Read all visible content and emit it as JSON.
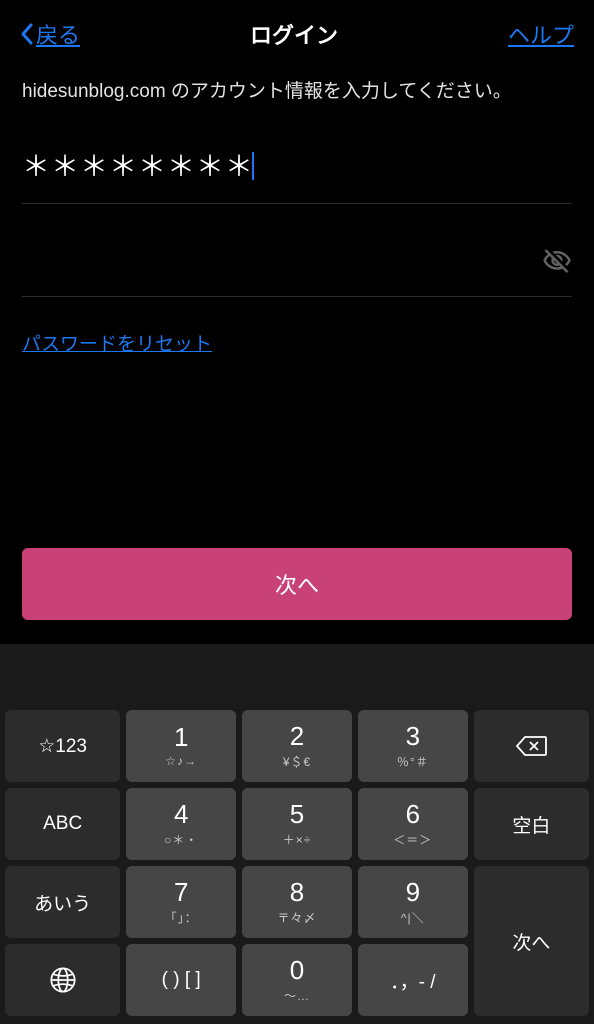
{
  "header": {
    "back_label": "戻る",
    "title": "ログイン",
    "help_label": "ヘルプ"
  },
  "form": {
    "instruction": "hidesunblog.com のアカウント情報を入力してください。",
    "username_mask": "＊＊＊＊＊＊＊＊",
    "reset_label": "パスワードをリセット",
    "next_button": "次へ"
  },
  "keyboard": {
    "keys": {
      "mode_symbol": "☆123",
      "k1": {
        "main": "1",
        "sub": "☆♪→"
      },
      "k2": {
        "main": "2",
        "sub": "¥＄€"
      },
      "k3": {
        "main": "3",
        "sub": "％°＃"
      },
      "abc": "ABC",
      "k4": {
        "main": "4",
        "sub": "○＊・"
      },
      "k5": {
        "main": "5",
        "sub": "＋×÷"
      },
      "k6": {
        "main": "6",
        "sub": "＜＝＞"
      },
      "space": "空白",
      "kana": "あいう",
      "k7": {
        "main": "7",
        "sub": "「」："
      },
      "k8": {
        "main": "8",
        "sub": "〒々〆"
      },
      "k9": {
        "main": "9",
        "sub": "^|＼"
      },
      "next": "次へ",
      "paren": {
        "main": "( ) [ ]",
        "sub": ""
      },
      "k0": {
        "main": "0",
        "sub": "～…"
      },
      "punct": {
        "main": "．，- /",
        "sub": ""
      }
    }
  }
}
